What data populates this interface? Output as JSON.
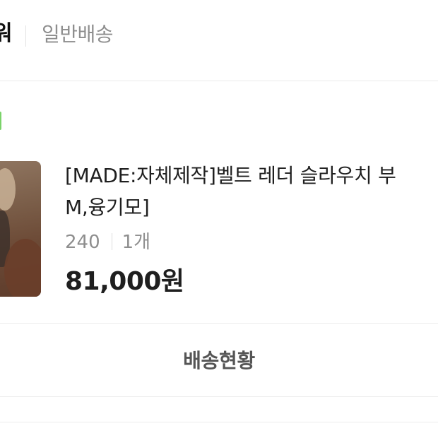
{
  "header": {
    "cut_title": "워",
    "delivery_type": "일반배송"
  },
  "order": {
    "status_color": "#7bd36a",
    "product": {
      "name_line1": "[MADE:자체제작]벨트 레더 슬라우치 부",
      "name_line2": "M,융기모]",
      "option": "240",
      "quantity": "1개",
      "price": "81,000원"
    },
    "actions": {
      "track_label": "배송현황"
    }
  }
}
